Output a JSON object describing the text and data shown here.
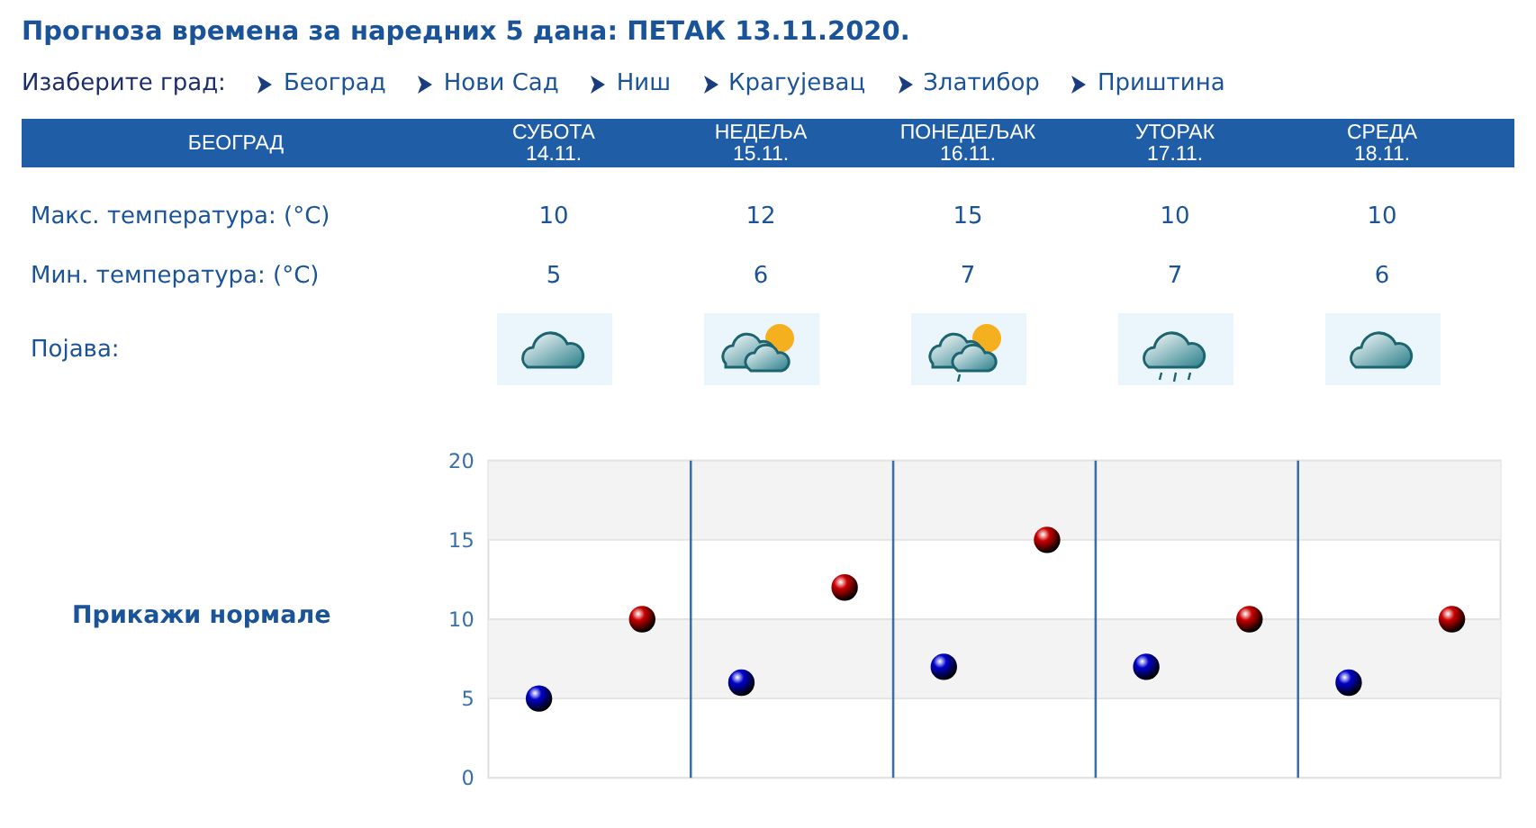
{
  "title": "Прогноза времена за наредних 5 дана: ПЕТАК  13.11.2020.",
  "city_picker": {
    "label": "Изаберите град:",
    "cities": [
      {
        "name": "Београд"
      },
      {
        "name": "Нови Сад"
      },
      {
        "name": "Ниш"
      },
      {
        "name": "Крагујевац"
      },
      {
        "name": "Златибор"
      },
      {
        "name": "Приштина"
      }
    ]
  },
  "table": {
    "city": "БЕОГРАД",
    "days": [
      {
        "day": "СУБОТА",
        "date": "14.11.",
        "max": "10",
        "min": "5",
        "kind": "cloud"
      },
      {
        "day": "НЕДЕЉА",
        "date": "15.11.",
        "max": "12",
        "min": "6",
        "kind": "sun-cloud"
      },
      {
        "day": "ПОНЕДЕЉАК",
        "date": "16.11.",
        "max": "15",
        "min": "7",
        "kind": "sun-cloud-rain"
      },
      {
        "day": "УТОРАК",
        "date": "17.11.",
        "max": "10",
        "min": "7",
        "kind": "rain"
      },
      {
        "day": "СРЕДА",
        "date": "18.11.",
        "max": "10",
        "min": "6",
        "kind": "cloud"
      }
    ],
    "max_label": "Макс. температура: (°C)",
    "min_label": "Мин. температура: (°C)",
    "phenomenon_label": "Појава:"
  },
  "normals_link": "Прикажи нормале",
  "chart_data": {
    "type": "scatter",
    "grid": true,
    "ylim": [
      0,
      20
    ],
    "yticks": [
      0,
      5,
      10,
      15,
      20
    ],
    "series": [
      {
        "color": "#0000cc",
        "values": [
          5,
          6,
          7,
          7,
          6
        ]
      },
      {
        "color": "#cc0000",
        "values": [
          10,
          12,
          15,
          10,
          10
        ]
      }
    ]
  }
}
